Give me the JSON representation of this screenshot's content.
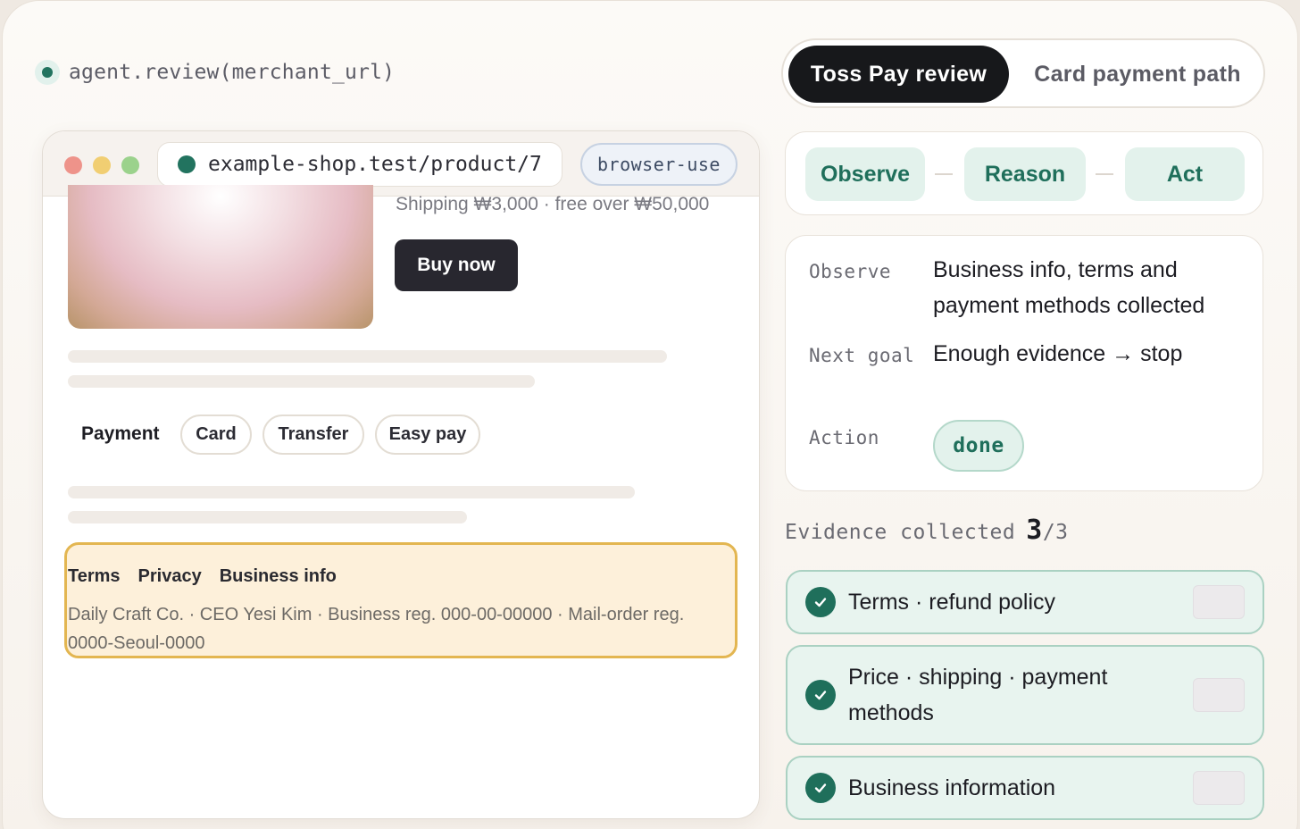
{
  "header": {
    "agent_call": "agent.review(merchant_url)",
    "tabs": [
      {
        "label": "Toss Pay review",
        "active": true
      },
      {
        "label": "Card payment path",
        "active": false
      }
    ]
  },
  "browser": {
    "url": "example-shop.test/product/7",
    "mode_tag": "browser-use",
    "shipping": "Shipping ₩3,000 · free over ₩50,000",
    "buy_label": "Buy now",
    "payment_label": "Payment",
    "payment_options": [
      "Card",
      "Transfer",
      "Easy pay"
    ],
    "footer_links": [
      "Terms",
      "Privacy",
      "Business info"
    ],
    "footer_text": "Daily Craft Co. · CEO Yesi Kim · Business reg. 000-00-00000 · Mail-order reg. 0000-Seoul-0000"
  },
  "loop": {
    "steps": [
      "Observe",
      "Reason",
      "Act"
    ]
  },
  "state": {
    "observe_key": "Observe",
    "observe_val": "Business info, terms and payment methods collected",
    "goal_key": "Next goal",
    "goal_val": "Enough evidence → stop",
    "action_key": "Action",
    "action_val": "done"
  },
  "evidence": {
    "label": "Evidence collected",
    "count": "3",
    "total": "/3",
    "items": [
      "Terms · refund policy",
      "Price · shipping · payment methods",
      "Business information"
    ]
  },
  "colors": {
    "accent": "#1f6f5b",
    "accent_soft": "#e3f2ec",
    "highlight_border": "#e3b651",
    "dark": "#17181b"
  }
}
